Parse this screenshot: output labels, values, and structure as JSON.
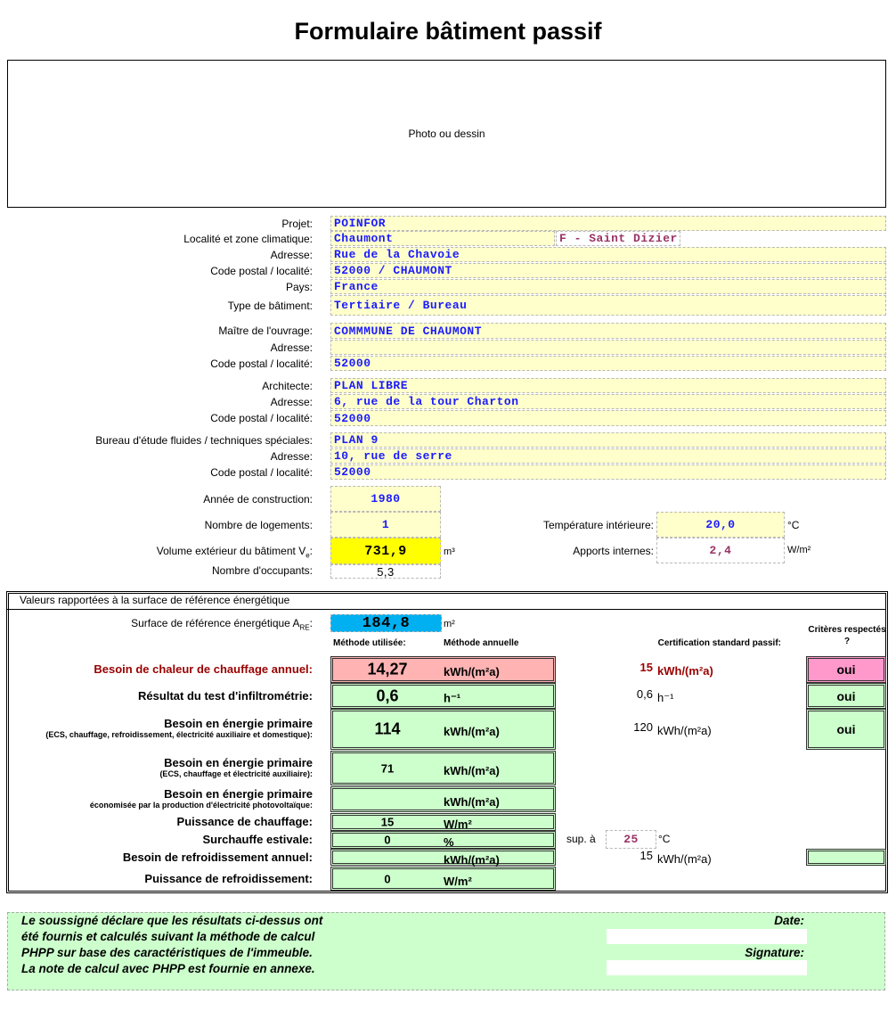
{
  "title": "Formulaire bâtiment passif",
  "photo": "Photo ou dessin",
  "project": [
    {
      "label": "Projet:",
      "value": "POINFOR"
    },
    {
      "label": "Localité et zone climatique:",
      "value": "Chaumont",
      "value2": "F - Saint Dizier"
    },
    {
      "label": "Adresse:",
      "value": "Rue de la Chavoie"
    },
    {
      "label": "Code postal / localité:",
      "value": "52000 / CHAUMONT"
    },
    {
      "label": "Pays:",
      "value": "France"
    },
    {
      "label": "Type de bâtiment:",
      "value": "Tertiaire / Bureau"
    },
    {
      "label": "Maître de l'ouvrage:",
      "value": "COMMMUNE DE CHAUMONT"
    },
    {
      "label": "Adresse:",
      "value": ""
    },
    {
      "label": "Code postal / localité:",
      "value": "52000"
    },
    {
      "label": "Architecte:",
      "value": "PLAN LIBRE"
    },
    {
      "label": "Adresse:",
      "value": "6, rue de la tour Charton"
    },
    {
      "label": "Code postal / localité:",
      "value": "52000"
    },
    {
      "label": "Bureau d'étude fluides / techniques spéciales:",
      "value": "PLAN 9"
    },
    {
      "label": "Adresse:",
      "value": "10, rue de serre"
    },
    {
      "label": "Code postal / localité:",
      "value": "52000"
    }
  ],
  "building": {
    "year_label": "Année de construction:",
    "year": "1980",
    "dwellings_label": "Nombre de logements:",
    "dwellings": "1",
    "volume_label": "Volume extérieur du bâtiment V",
    "volume_sub": "e",
    "volume": "731,9",
    "volume_unit": "m³",
    "occupants_label": "Nombre d'occupants:",
    "occupants": "5,3",
    "temp_label": "Température intérieure:",
    "temp": "20,0",
    "temp_unit": "°C",
    "gains_label": "Apports internes:",
    "gains": "2,4",
    "gains_unit": "W/m²"
  },
  "results": {
    "header": "Valeurs rapportées à la surface de référence énergétique",
    "area_label": "Surface de référence énergétique A",
    "area_sub": "RE",
    "area": "184,8",
    "area_unit": "m²",
    "method_label": "Méthode utilisée:",
    "method": "Méthode annuelle",
    "cert_label": "Certification standard passif:",
    "criteria_label": "Critères respectés ?",
    "rows": [
      {
        "label": "Besoin de chaleur de chauffage annuel:",
        "value": "14,27",
        "unit": "kWh/(m²a)",
        "cert": "15",
        "cert_unit": "kWh/(m²a)",
        "ok": "oui"
      },
      {
        "label": "Résultat du test d'infiltrométrie:",
        "value": "0,6",
        "unit": "h⁻¹",
        "cert": "0,6",
        "cert_unit": "h⁻¹",
        "ok": "oui"
      },
      {
        "label": "Besoin en énergie primaire",
        "sub": "(ECS, chauffage, refroidissement, électricité auxiliaire et domestique):",
        "value": "114",
        "unit": "kWh/(m²a)",
        "cert": "120",
        "cert_unit": "kWh/(m²a)",
        "ok": "oui"
      },
      {
        "label": "Besoin en énergie primaire",
        "sub": "(ECS, chauffage et électricité auxiliaire):",
        "value": "71",
        "unit": "kWh/(m²a)"
      },
      {
        "label": "Besoin en énergie primaire",
        "sub": "économisée par la production d'électricité photovoltaïque:",
        "value": "",
        "unit": "kWh/(m²a)"
      },
      {
        "label": "Puissance de chauffage:",
        "value": "15",
        "unit": "W/m²"
      },
      {
        "label": "Surchauffe estivale:",
        "value": "0",
        "unit": "%",
        "cert_prefix": "sup. à",
        "cert_input": "25",
        "cert_unit": "°C"
      },
      {
        "label": "Besoin de refroidissement annuel:",
        "value": "",
        "unit": "kWh/(m²a)",
        "cert": "15",
        "cert_unit": "kWh/(m²a)",
        "ok": ""
      },
      {
        "label": "Puissance de refroidissement:",
        "value": "0",
        "unit": "W/m²"
      }
    ]
  },
  "footer": {
    "lines": [
      "Le soussigné déclare que les résultats ci-dessus ont",
      "été fournis et calculés suivant la méthode de calcul",
      "PHPP sur base des caractéristiques de l'immeuble.",
      "La note de calcul avec PHPP est fournie en annexe."
    ],
    "date_label": "Date:",
    "signature_label": "Signature:",
    "date": "",
    "signature": ""
  },
  "colors": {
    "input_yellow": "#ffffcc",
    "volume_yellow": "#ffff00",
    "area_blue": "#00b0f0",
    "fail_pink": "#ffb3b3",
    "criteria_pink": "#ff99cc",
    "result_green": "#ccffcc",
    "dark_red": "#990000"
  }
}
